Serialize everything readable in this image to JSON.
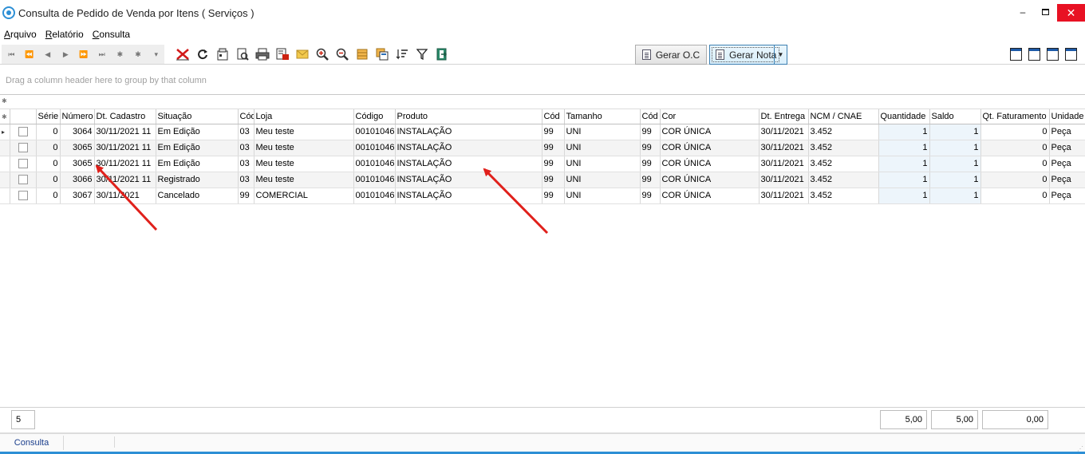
{
  "window": {
    "title": "Consulta de Pedido de Venda por Itens ( Serviços )",
    "min_label": "‒",
    "close_label": "✕"
  },
  "menu": [
    "Arquivo",
    "Relatório",
    "Consulta"
  ],
  "toolbar": {
    "nav_buttons": [
      "⏮",
      "⏪",
      "◀",
      "▶",
      "⏩",
      "⏭",
      "✱",
      "✱",
      "▾"
    ],
    "gerar_oc_label": "Gerar O.C",
    "gerar_nota_label": "Gerar Nota",
    "dropdown_arrow": "▼"
  },
  "group_hint": "Drag a column header here to group by that column",
  "grid": {
    "indicator_glyph": "▸",
    "filter_glyph": "✱",
    "columns": [
      "",
      "",
      "Série",
      "Número",
      "Dt. Cadastro",
      "Situação",
      "Cód",
      "Loja",
      "Código",
      "Produto",
      "Cód",
      "Tamanho",
      "Cód",
      "Cor",
      "Dt. Entrega",
      "NCM / CNAE",
      "Quantidade",
      "Saldo",
      "Qt. Faturamento",
      "Unidade"
    ],
    "rows": [
      {
        "serie": "0",
        "numero": "3064",
        "dt_cadastro": "30/11/2021 11",
        "situacao": "Em Edição",
        "cod_loja": "03",
        "loja": "Meu teste",
        "codigo": "00101046",
        "produto": "INSTALAÇÃO",
        "cod_tam": "99",
        "tamanho": "UNI",
        "cod_cor": "99",
        "cor": "COR ÚNICA",
        "dt_entrega": "30/11/2021",
        "ncm": "3.452",
        "quantidade": "1",
        "saldo": "1",
        "qt_faturamento": "0",
        "unidade": "Peça"
      },
      {
        "serie": "0",
        "numero": "3065",
        "dt_cadastro": "30/11/2021 11",
        "situacao": "Em Edição",
        "cod_loja": "03",
        "loja": "Meu teste",
        "codigo": "00101046",
        "produto": "INSTALAÇÃO",
        "cod_tam": "99",
        "tamanho": "UNI",
        "cod_cor": "99",
        "cor": "COR ÚNICA",
        "dt_entrega": "30/11/2021",
        "ncm": "3.452",
        "quantidade": "1",
        "saldo": "1",
        "qt_faturamento": "0",
        "unidade": "Peça"
      },
      {
        "serie": "0",
        "numero": "3065",
        "dt_cadastro": "30/11/2021 11",
        "situacao": "Em Edição",
        "cod_loja": "03",
        "loja": "Meu teste",
        "codigo": "00101046",
        "produto": "INSTALAÇÃO",
        "cod_tam": "99",
        "tamanho": "UNI",
        "cod_cor": "99",
        "cor": "COR ÚNICA",
        "dt_entrega": "30/11/2021",
        "ncm": "3.452",
        "quantidade": "1",
        "saldo": "1",
        "qt_faturamento": "0",
        "unidade": "Peça"
      },
      {
        "serie": "0",
        "numero": "3066",
        "dt_cadastro": "30/11/2021 11",
        "situacao": "Registrado",
        "cod_loja": "03",
        "loja": "Meu teste",
        "codigo": "00101046",
        "produto": "INSTALAÇÃO",
        "cod_tam": "99",
        "tamanho": "UNI",
        "cod_cor": "99",
        "cor": "COR ÚNICA",
        "dt_entrega": "30/11/2021",
        "ncm": "3.452",
        "quantidade": "1",
        "saldo": "1",
        "qt_faturamento": "0",
        "unidade": "Peça"
      },
      {
        "serie": "0",
        "numero": "3067",
        "dt_cadastro": "30/11/2021",
        "situacao": "Cancelado",
        "cod_loja": "99",
        "loja": "COMERCIAL",
        "codigo": "00101046",
        "produto": "INSTALAÇÃO",
        "cod_tam": "99",
        "tamanho": "UNI",
        "cod_cor": "99",
        "cor": "COR ÚNICA",
        "dt_entrega": "30/11/2021",
        "ncm": "3.452",
        "quantidade": "1",
        "saldo": "1",
        "qt_faturamento": "0",
        "unidade": "Peça"
      }
    ]
  },
  "footer": {
    "count": "5",
    "total_quantidade": "5,00",
    "total_saldo": "5,00",
    "total_faturamento": "0,00"
  },
  "tabs": [
    "Consulta"
  ],
  "colors": {
    "accent": "#2d8fd5",
    "annotation_arrow": "#e0201b",
    "highlight_cell": "#edf5fb",
    "close_button": "#e81123"
  }
}
